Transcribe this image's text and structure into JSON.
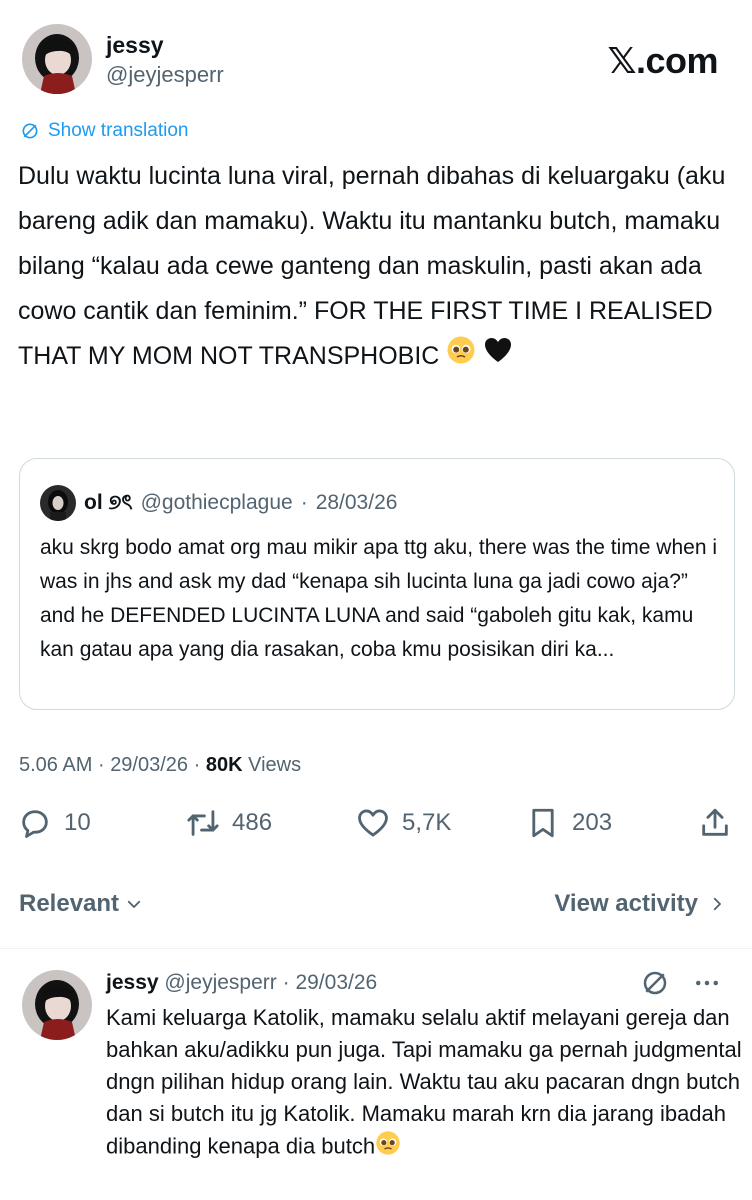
{
  "brand": {
    "x": "𝕏",
    "dotcom": ".com"
  },
  "tweet": {
    "author_name": "jessy",
    "author_handle": "@jeyjesperr",
    "show_translation": "Show translation",
    "text": "Dulu waktu lucinta luna viral, pernah dibahas di keluargaku (aku bareng adik dan mamaku). Waktu itu mantanku butch, mamaku bilang “kalau ada cewe ganteng dan maskulin, pasti akan ada cowo cantik dan feminim.” FOR THE FIRST TIME I REALISED THAT MY MOM NOT TRANSPHOBIC",
    "emojis": [
      "pleading-face",
      "black-heart"
    ]
  },
  "quote": {
    "name": "ol ୭ৎ",
    "handle": "@gothiecplague",
    "separator": "·",
    "date": "28/03/26",
    "text": "aku skrg bodo amat org mau mikir apa ttg aku, there was the time when i was in jhs and ask my dad “kenapa sih lucinta luna ga jadi cowo aja?” and he DEFENDED LUCINTA LUNA and said “gaboleh gitu kak, kamu kan gatau apa yang dia rasakan, coba kmu posisikan diri ka..."
  },
  "meta": {
    "time": "5.06 AM",
    "sep1": "·",
    "date": "29/03/26",
    "sep2": "·",
    "views_count": "80K",
    "views_label": "Views"
  },
  "actions": {
    "replies": "10",
    "reposts": "486",
    "likes": "5,7K",
    "bookmarks": "203"
  },
  "filter": {
    "relevant": "Relevant",
    "view_activity": "View activity"
  },
  "reply": {
    "name": "jessy",
    "handle": "@jeyjesperr",
    "separator": "·",
    "date": "29/03/26",
    "text": "Kami keluarga Katolik, mamaku selalu aktif melayani gereja dan bahkan aku/adikku pun juga. Tapi mamaku ga pernah judgmental dngn pilihan hidup orang lain. Waktu tau aku pacaran dngn butch dan si butch itu jg Katolik. Mamaku marah krn dia jarang ibadah dibanding kenapa dia butch",
    "emoji": "pleading-face"
  },
  "colors": {
    "text": "#0f1419",
    "muted": "#536471",
    "link": "#1d9bf0",
    "border": "#cfd9de"
  }
}
